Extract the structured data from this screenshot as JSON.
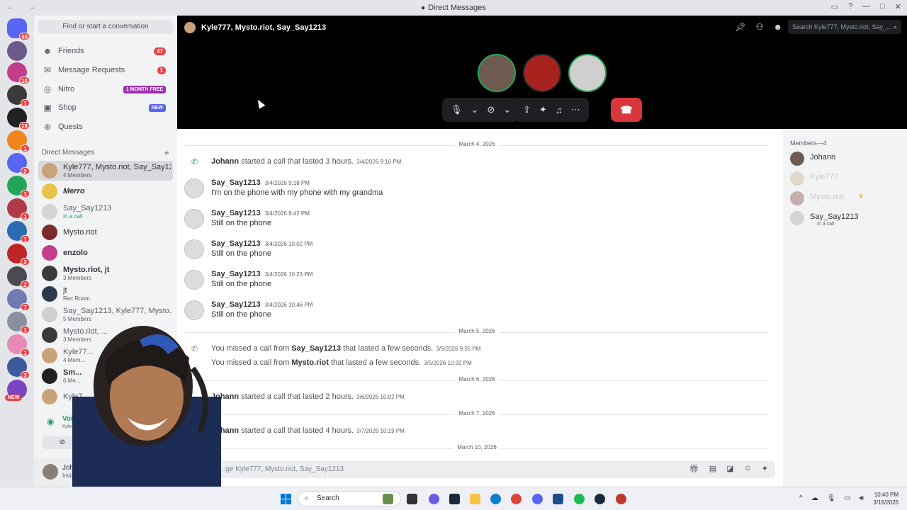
{
  "window": {
    "title": "Direct Messages"
  },
  "sidebar": {
    "find_placeholder": "Find or start a conversation",
    "nav": [
      {
        "label": "Friends",
        "count": "47"
      },
      {
        "label": "Message Requests",
        "count": "1"
      },
      {
        "label": "Nitro",
        "tag": "1 MONTH FREE"
      },
      {
        "label": "Shop",
        "tag": "NEW"
      },
      {
        "label": "Quests"
      }
    ],
    "dm_header": "Direct Messages",
    "dms": [
      {
        "name": "Kyle777, Mysto.riot, Say_Say1213",
        "sub": "4 Members"
      },
      {
        "name": "Merro",
        "sub": ""
      },
      {
        "name": "Say_Say1213",
        "sub": "In a call"
      },
      {
        "name": "Mysto.riot",
        "sub": ""
      },
      {
        "name": "enzolo",
        "sub": ""
      },
      {
        "name": "Mysto.riot, jt",
        "sub": "3 Members"
      },
      {
        "name": "jt",
        "sub": "Rec Room"
      },
      {
        "name": "Say_Say1213, Kyle777, Mysto.rio...",
        "sub": "5 Members"
      },
      {
        "name": "Mysto.riot, ...",
        "sub": "3 Members"
      },
      {
        "name": "Kyle77...",
        "sub": "4 Mem..."
      },
      {
        "name": "Sm...",
        "sub": "6 Me..."
      },
      {
        "name": "Kyle7...",
        "sub": ""
      }
    ],
    "voice": {
      "status": "Voice Connect...",
      "channel": "Kyle777, Mysto.riot..."
    },
    "user": {
      "name": "Johann",
      "status": "Invisible"
    }
  },
  "servers": {
    "home_badge": "49",
    "badges": [
      "10",
      "1",
      "19",
      "1",
      "2",
      "1",
      "1",
      "1",
      "2",
      "2",
      "7",
      "1",
      "1",
      "3"
    ],
    "new_label": "NEW"
  },
  "call": {
    "header": "Kyle777, Mysto.riot, Say_Say1213",
    "search_placeholder": "Search Kyle777, Mysto.riot, Say_..."
  },
  "chat": {
    "dividers": [
      "March 4, 2026",
      "March 5, 2026",
      "March 6, 2026",
      "March 7, 2026",
      "March 10, 2026"
    ],
    "system": [
      {
        "name": "Johann",
        "text": "started a call that lasted 3 hours.",
        "time": "3/4/2026 9:16 PM"
      },
      {
        "prefix": "You missed a call from",
        "name": "Say_Say1213",
        "text": "that lasted a few seconds.",
        "time": "3/5/2026 9:55 PM"
      },
      {
        "prefix": "You missed a call from",
        "name": "Mysto.riot",
        "text": "that lasted a few seconds.",
        "time": "3/5/2026 10:32 PM"
      },
      {
        "name": "Johann",
        "text": "started a call that lasted 2 hours.",
        "time": "3/6/2026 10:02 PM"
      },
      {
        "name": "Johann",
        "text": "started a call that lasted 4 hours.",
        "time": "3/7/2026 10:19 PM"
      }
    ],
    "messages": [
      {
        "author": "Say_Say1213",
        "time": "3/4/2026 9:18 PM",
        "text": "I'm on the phone with my phone with my grandma"
      },
      {
        "author": "Say_Say1213",
        "time": "3/4/2026 9:42 PM",
        "text": "Still on the phone"
      },
      {
        "author": "Say_Say1213",
        "time": "3/4/2026 10:02 PM",
        "text": "Still on the phone"
      },
      {
        "author": "Say_Say1213",
        "time": "3/4/2026 10:23 PM",
        "text": "Still on the phone"
      },
      {
        "author": "Say_Say1213",
        "time": "3/4/2026 10:46 PM",
        "text": "Still on the phone"
      }
    ],
    "composer_placeholder": "...ge Kyle777, Mysto.riot, Say_Say1213"
  },
  "members": {
    "header": "Members—4",
    "list": [
      {
        "name": "Johann",
        "sub": ""
      },
      {
        "name": "Kyle777",
        "sub": ""
      },
      {
        "name": "Mysto.riot",
        "sub": ""
      },
      {
        "name": "Say_Say1213",
        "sub": "In a call"
      }
    ]
  },
  "taskbar": {
    "search": "Search",
    "time": "10:40 PM",
    "date": "3/16/2026"
  },
  "colors": {
    "blurple": "#5865f2",
    "danger": "#da373c",
    "online": "#23a559",
    "nitro": "#a02fb5"
  }
}
